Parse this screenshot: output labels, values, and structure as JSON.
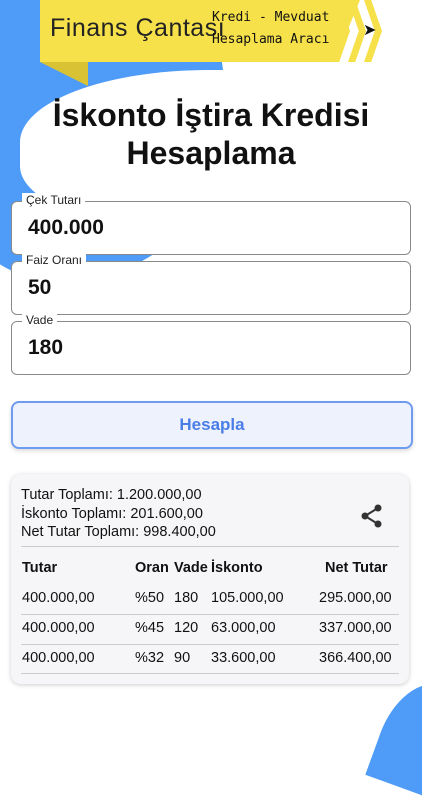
{
  "banner": {
    "brand": "Finans Çantası",
    "tagline_line1": "Kredi - Mevduat",
    "tagline_line2": "Hesaplama Aracı"
  },
  "page": {
    "title_line1": "İskonto İştira Kredisi",
    "title_line2": "Hesaplama"
  },
  "form": {
    "amount": {
      "label": "Çek Tutarı",
      "value": "400.000"
    },
    "rate": {
      "label": "Faiz Oranı",
      "value": "50"
    },
    "term": {
      "label": "Vade",
      "value": "180"
    },
    "submit_label": "Hesapla"
  },
  "results": {
    "summary": {
      "total": "Tutar Toplamı: 1.200.000,00",
      "discount": "İskonto Toplamı: 201.600,00",
      "net": "Net Tutar Toplamı: 998.400,00"
    },
    "columns": [
      "Tutar",
      "Oran",
      "Vade",
      "İskonto",
      "Net Tutar"
    ],
    "rows": [
      [
        "400.000,00",
        "%50",
        "180",
        "105.000,00",
        "295.000,00"
      ],
      [
        "400.000,00",
        "%45",
        "120",
        "63.000,00",
        "337.000,00"
      ],
      [
        "400.000,00",
        "%32",
        "90",
        "33.600,00",
        "366.400,00"
      ]
    ]
  },
  "colors": {
    "accent": "#4e9bf8",
    "banner": "#f6e14b",
    "button_text": "#4a7ee6"
  },
  "icons": {
    "share": "share-icon",
    "arrow": "arrow-icon"
  }
}
